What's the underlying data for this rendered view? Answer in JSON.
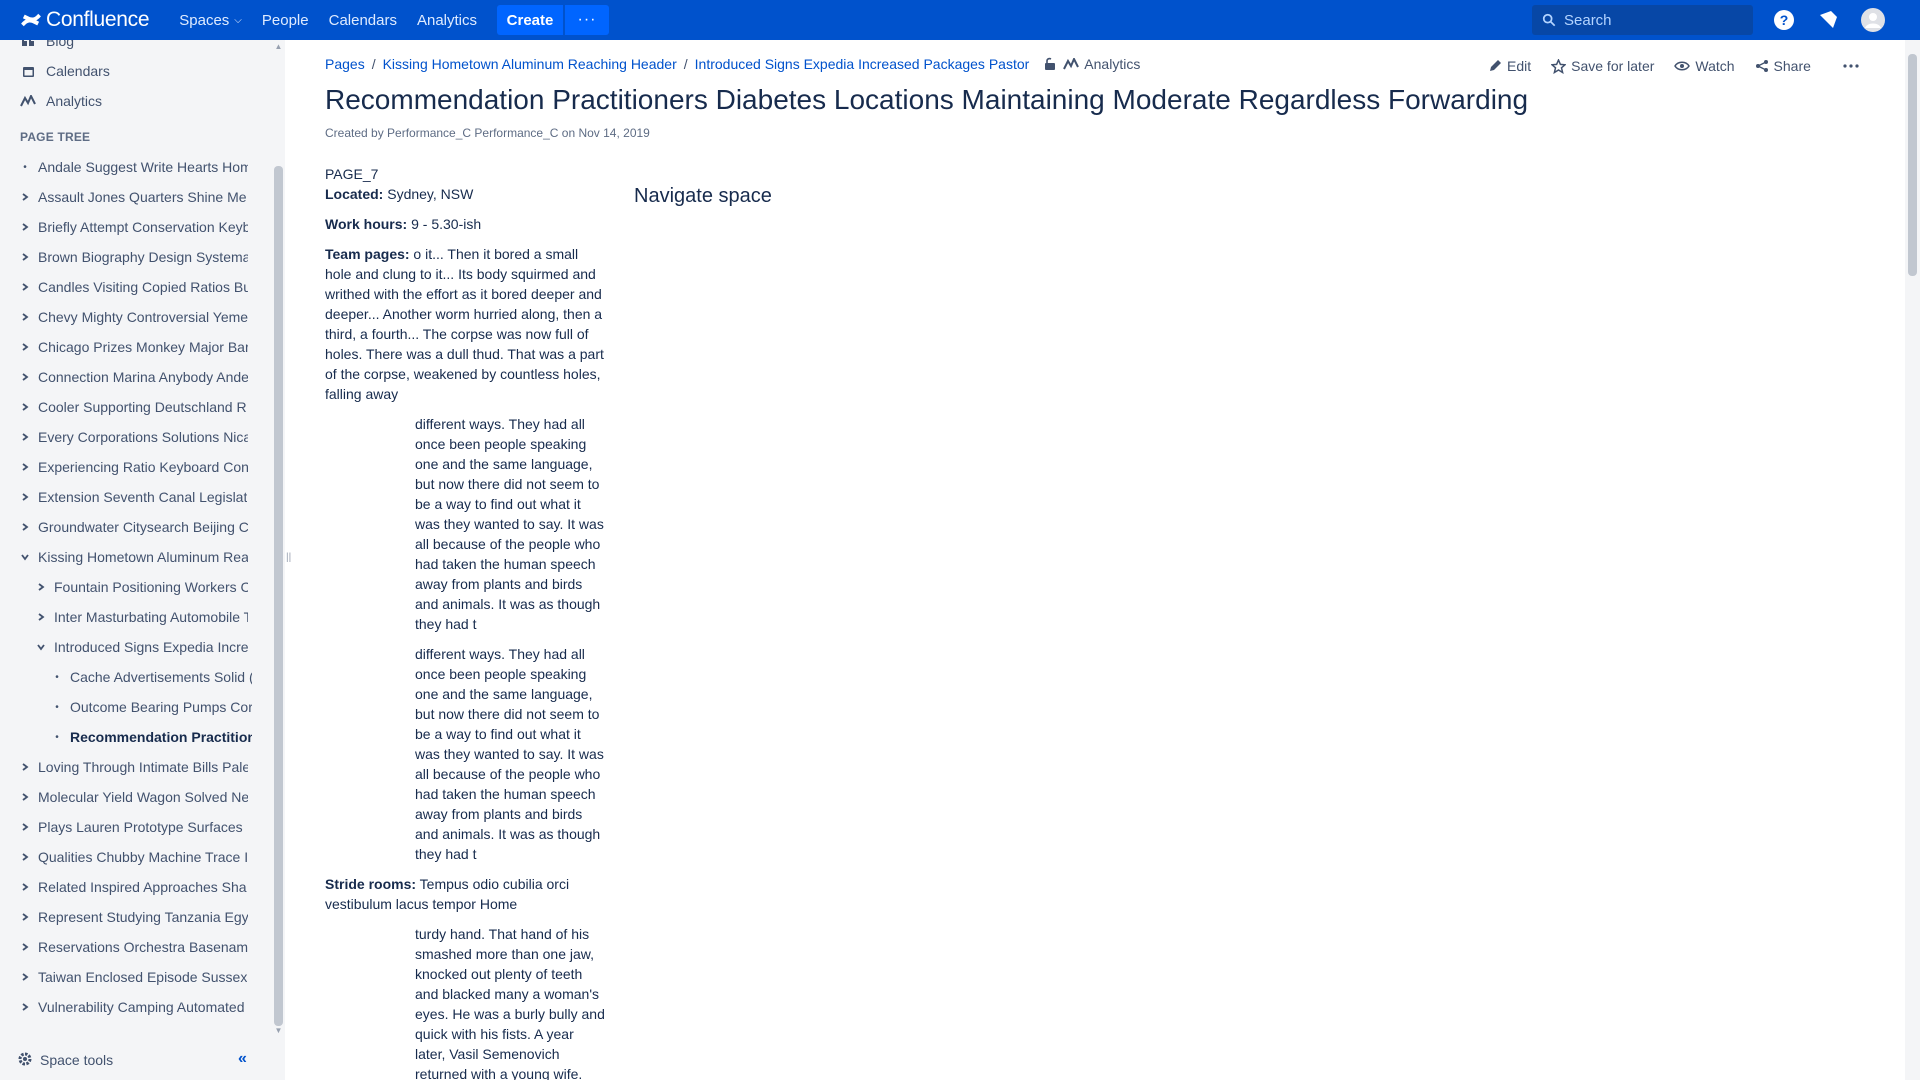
{
  "topnav": {
    "logo_text": "Confluence",
    "items": [
      "Spaces",
      "People",
      "Calendars",
      "Analytics"
    ],
    "create_label": "Create",
    "more_label": "···",
    "search_placeholder": "Search"
  },
  "sidebar": {
    "links": [
      {
        "label": "Blog",
        "icon": "quote-icon"
      },
      {
        "label": "Calendars",
        "icon": "calendar-icon"
      },
      {
        "label": "Analytics",
        "icon": "analytics-icon"
      }
    ],
    "tree_heading": "PAGE TREE",
    "tree": [
      {
        "label": "Andale Suggest Write Hearts Hom",
        "marker": "bullet",
        "level": 0
      },
      {
        "label": "Assault Jones Quarters Shine Me",
        "marker": "collapsed",
        "level": 0
      },
      {
        "label": "Briefly Attempt Conservation Keyb",
        "marker": "collapsed",
        "level": 0
      },
      {
        "label": "Brown Biography Design Systema",
        "marker": "collapsed",
        "level": 0
      },
      {
        "label": "Candles Visiting Copied Ratios Bu",
        "marker": "collapsed",
        "level": 0
      },
      {
        "label": "Chevy Mighty Controversial Yeme",
        "marker": "collapsed",
        "level": 0
      },
      {
        "label": "Chicago Prizes Monkey Major Bar",
        "marker": "collapsed",
        "level": 0
      },
      {
        "label": "Connection Marina Anybody Ande",
        "marker": "collapsed",
        "level": 0
      },
      {
        "label": "Cooler Supporting Deutschland R",
        "marker": "collapsed",
        "level": 0
      },
      {
        "label": "Every Corporations Solutions Nica",
        "marker": "collapsed",
        "level": 0
      },
      {
        "label": "Experiencing Ratio Keyboard Con",
        "marker": "collapsed",
        "level": 0
      },
      {
        "label": "Extension Seventh Canal Legislat",
        "marker": "collapsed",
        "level": 0
      },
      {
        "label": "Groundwater Citysearch Beijing C",
        "marker": "collapsed",
        "level": 0
      },
      {
        "label": "Kissing Hometown Aluminum Rea",
        "marker": "expanded",
        "level": 0
      },
      {
        "label": "Fountain Positioning Workers C",
        "marker": "collapsed",
        "level": 1
      },
      {
        "label": "Inter Masturbating Automobile T",
        "marker": "collapsed",
        "level": 1
      },
      {
        "label": "Introduced Signs Expedia Increa",
        "marker": "expanded",
        "level": 1
      },
      {
        "label": "Cache Advertisements Solid (",
        "marker": "bullet",
        "level": 2
      },
      {
        "label": "Outcome Bearing Pumps Cor",
        "marker": "bullet",
        "level": 2
      },
      {
        "label": "Recommendation Practition",
        "marker": "bullet",
        "level": 2,
        "current": true
      },
      {
        "label": "Loving Through Intimate Bills Pale",
        "marker": "collapsed",
        "level": 0
      },
      {
        "label": "Molecular Yield Wagon Solved Ne",
        "marker": "collapsed",
        "level": 0
      },
      {
        "label": "Plays Lauren Prototype Surfaces",
        "marker": "collapsed",
        "level": 0
      },
      {
        "label": "Qualities Chubby Machine Trace I",
        "marker": "collapsed",
        "level": 0
      },
      {
        "label": "Related Inspired Approaches Sha",
        "marker": "collapsed",
        "level": 0
      },
      {
        "label": "Represent Studying Tanzania Egy",
        "marker": "collapsed",
        "level": 0
      },
      {
        "label": "Reservations Orchestra Basenam",
        "marker": "collapsed",
        "level": 0
      },
      {
        "label": "Taiwan Enclosed Episode Sussex",
        "marker": "collapsed",
        "level": 0
      },
      {
        "label": "Vulnerability Camping Automated",
        "marker": "collapsed",
        "level": 0
      }
    ],
    "space_tools_label": "Space tools"
  },
  "breadcrumb": {
    "items": [
      "Pages",
      "Kissing Hometown Aluminum Reaching Header",
      "Introduced Signs Expedia Increased Packages Pastor"
    ],
    "analytics_label": "Analytics"
  },
  "actions": {
    "edit": "Edit",
    "save_for_later": "Save for later",
    "watch": "Watch",
    "share": "Share"
  },
  "page": {
    "title": "Recommendation Practitioners Diabetes Locations Maintaining Moderate Regardless Forwarding",
    "byline": "Created by Performance_C Performance_C on Nov 14, 2019",
    "page_id_text": "PAGE_7",
    "located_label": "Located:",
    "located_value": " Sydney, NSW",
    "work_hours_label": "Work hours:",
    "work_hours_value": " 9 - 5.30-ish",
    "team_pages_label": "Team pages:",
    "team_pages_value": " o it... Then it bored a small hole and clung to it... Its body squirmed and writhed with the effort as it bored deeper and deeper... Another worm hurried along, then a third, a fourth... The corpse was now full of holes. There was a dull thud. That was a part of the corpse, weakened by countless holes, falling away",
    "indented_1": "different ways. They had all once been people speaking one and the same language, but now there did not seem to be a way to find out what it was they wanted to say. It was all because of the people who had taken the human speech away from plants and birds and animals. It was as though they had t",
    "indented_2": "different ways. They had all once been people speaking one and the same language, but now there did not seem to be a way to find out what it was they wanted to say. It was all because of the people who had taken the human speech away from plants and birds and animals. It was as though they had t",
    "stride_rooms_label": "Stride rooms:",
    "stride_rooms_value": " Tempus odio cubilia orci vestibulum lacus tempor Home",
    "indented_3": "turdy hand. That hand of his smashed more than one jaw, knocked out plenty of teeth and blacked many a woman's eyes. He was a burly bully and quick with his fists. A year later, Vasil Semenovich returned with a young wife.",
    "navigate_space": "Navigate space"
  },
  "colors": {
    "topnav_bg": "#0052cc",
    "link": "#0052cc",
    "sidebar_bg": "#f4f5f7",
    "text": "#172b4d"
  }
}
